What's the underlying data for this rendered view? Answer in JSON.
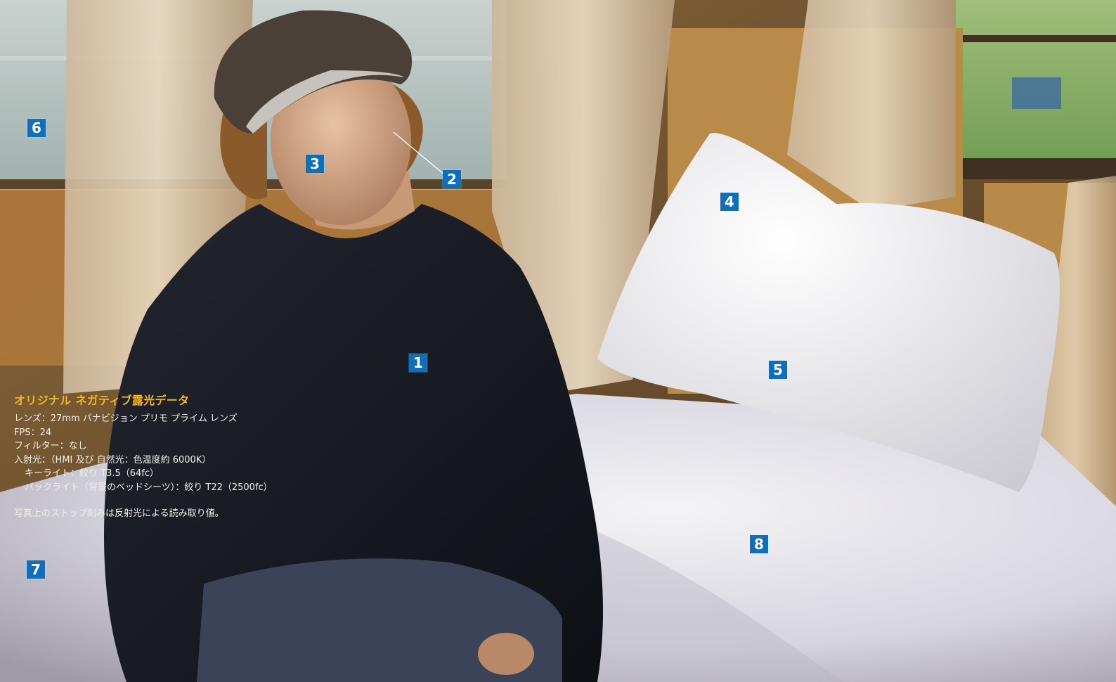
{
  "exposure_info": {
    "title": "オリジナル ネガティブ露光データ",
    "lens": "レンズ：27mm パナビジョン プリモ プライム レンズ",
    "fps": "FPS：24",
    "filter": "フィルター：なし",
    "incident": "入射光：（HMI 及び 自然光：色温度約 6000K）",
    "key_light": "キーライト：絞り T3.5（64fc）",
    "back_light": "バックライト（背景のベッドシーツ）：絞り T22（2500fc）",
    "note": "写真上のストップ刻みは反射光による読み取り値。"
  },
  "markers": [
    {
      "label": "1"
    },
    {
      "label": "2"
    },
    {
      "label": "3"
    },
    {
      "label": "4"
    },
    {
      "label": "5"
    },
    {
      "label": "6"
    },
    {
      "label": "7"
    },
    {
      "label": "8"
    }
  ],
  "colors": {
    "marker": "#0f6fbf",
    "title": "#f3b71c",
    "text": "#f2efe9"
  }
}
